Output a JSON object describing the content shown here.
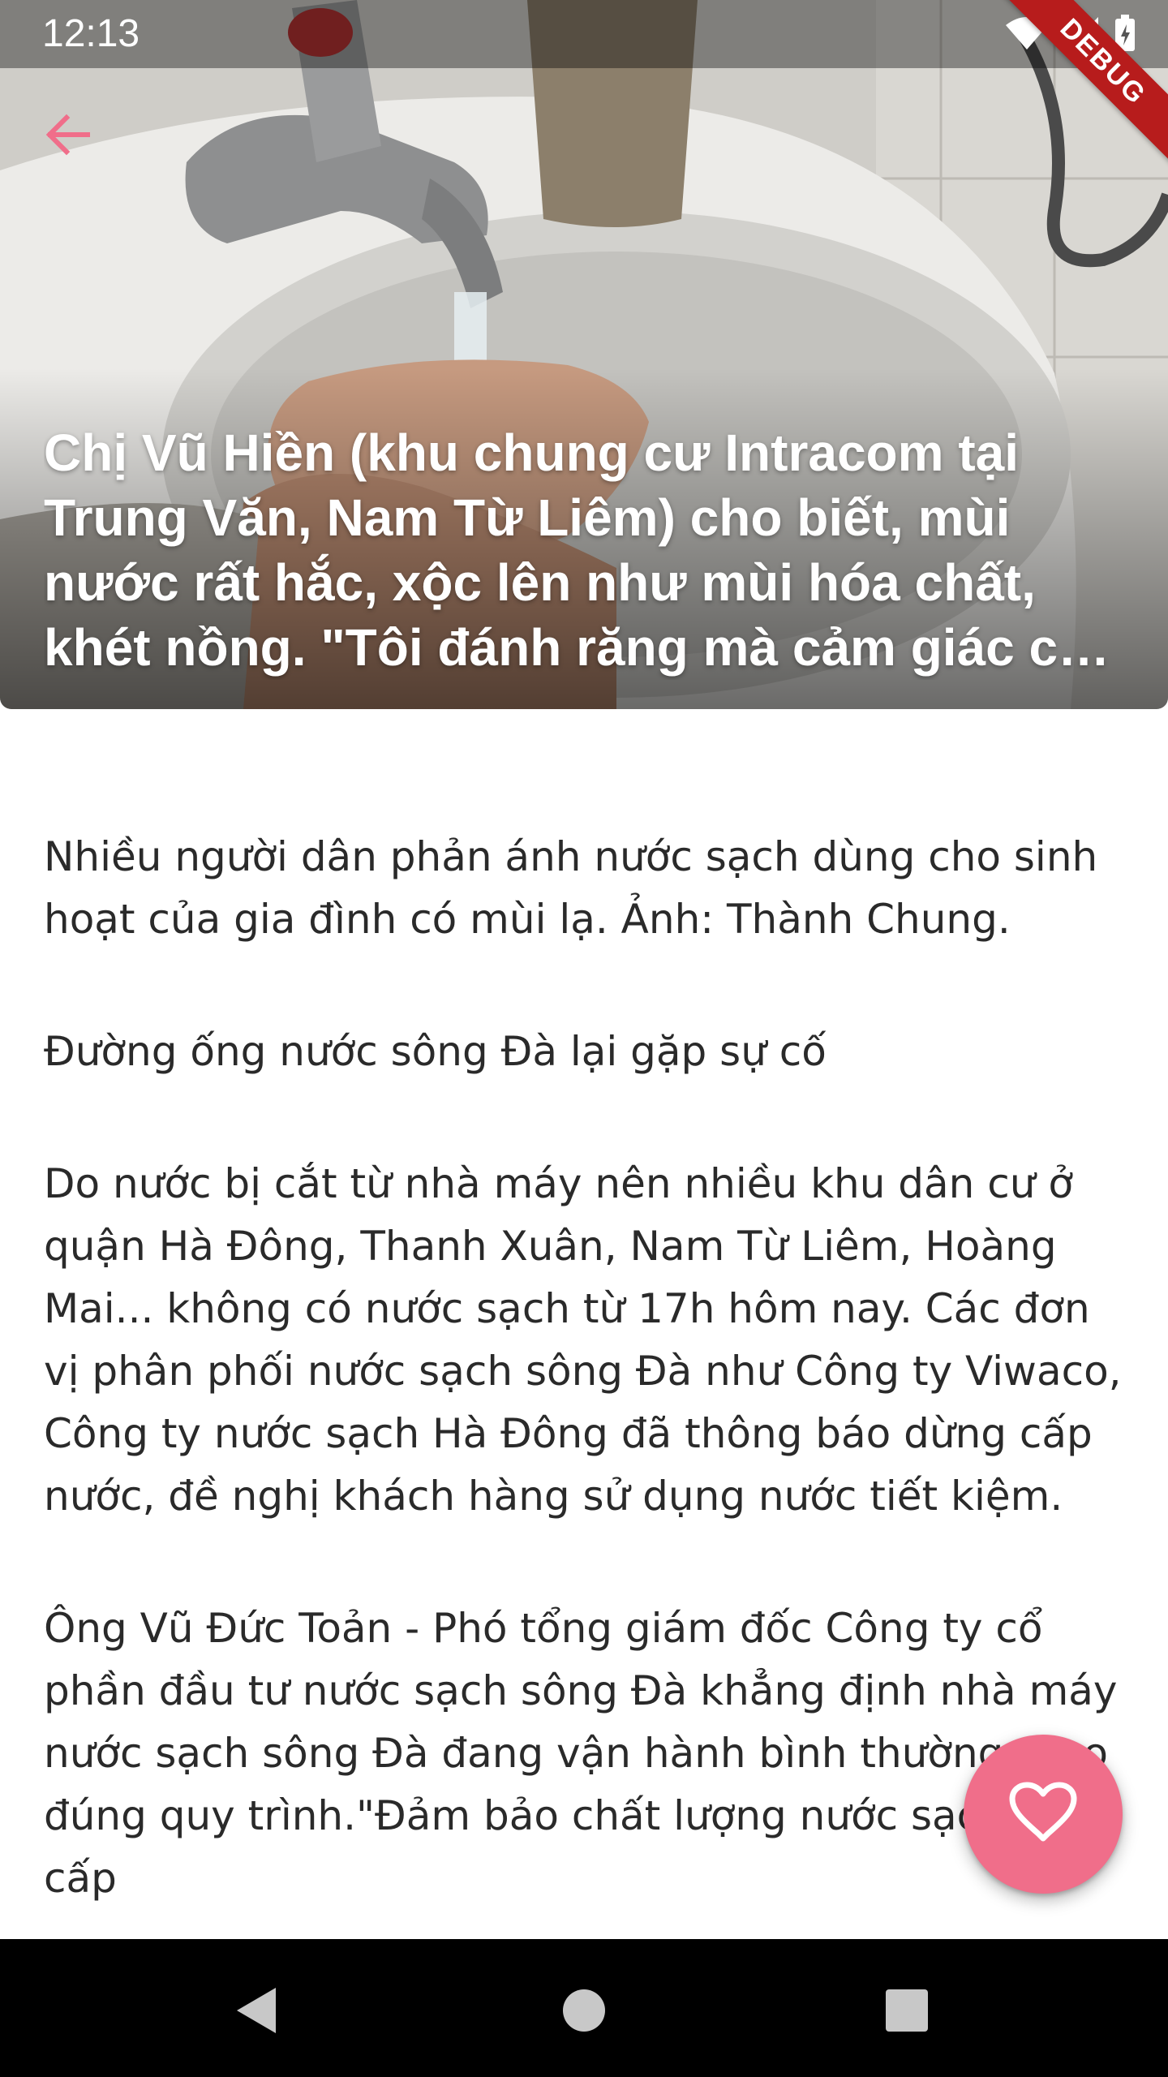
{
  "status_bar": {
    "time": "12:13"
  },
  "debug_banner": {
    "label": "DEBUG"
  },
  "hero": {
    "title": "Chị Vũ Hiền (khu chung cư Intracom tại Trung Văn, Nam Từ Liêm) cho biết, mùi nước rất hắc, xộc lên như mùi hóa chất, khét nồng. \"Tôi đánh răng mà cảm giác cay cả miệng\"",
    "image_description_icon": "photo-hand-washing-sink"
  },
  "toolbar": {
    "back_icon": "arrow-back-icon"
  },
  "article": {
    "paragraphs": [
      "Nhiều người dân phản ánh nước sạch dùng cho sinh hoạt của gia đình có mùi lạ. Ảnh: Thành Chung.",
      "Đường ống nước sông Đà lại gặp sự cố",
      "Do nước bị cắt từ nhà máy nên nhiều khu dân cư ở quận Hà Đông, Thanh Xuân, Nam Từ Liêm, Hoàng Mai... không có nước sạch từ 17h hôm nay. Các đơn vị phân phối nước sạch sông Đà như Công ty Viwaco, Công ty nước sạch Hà Đông đã thông báo dừng cấp nước, đề nghị khách hàng sử dụng nước tiết kiệm.",
      "Ông Vũ Đức Toản - Phó tổng giám đốc Công ty cổ phần đầu tư nước sạch sông Đà khẳng định nhà máy nước sạch sông Đà đang vận hành bình thường theo đúng quy trình.\"Đảm bảo chất lượng nước sạch cung cấp"
    ]
  },
  "fab": {
    "icon": "heart-outline-icon"
  },
  "nav_bar": {
    "back_icon": "nav-back-triangle-icon",
    "home_icon": "nav-home-circle-icon",
    "recents_icon": "nav-recents-square-icon"
  },
  "colors": {
    "accent": "#f06e8a",
    "debug_red": "#b71c1c",
    "nav_bar": "#000000",
    "body_text": "#2a2a2a"
  }
}
